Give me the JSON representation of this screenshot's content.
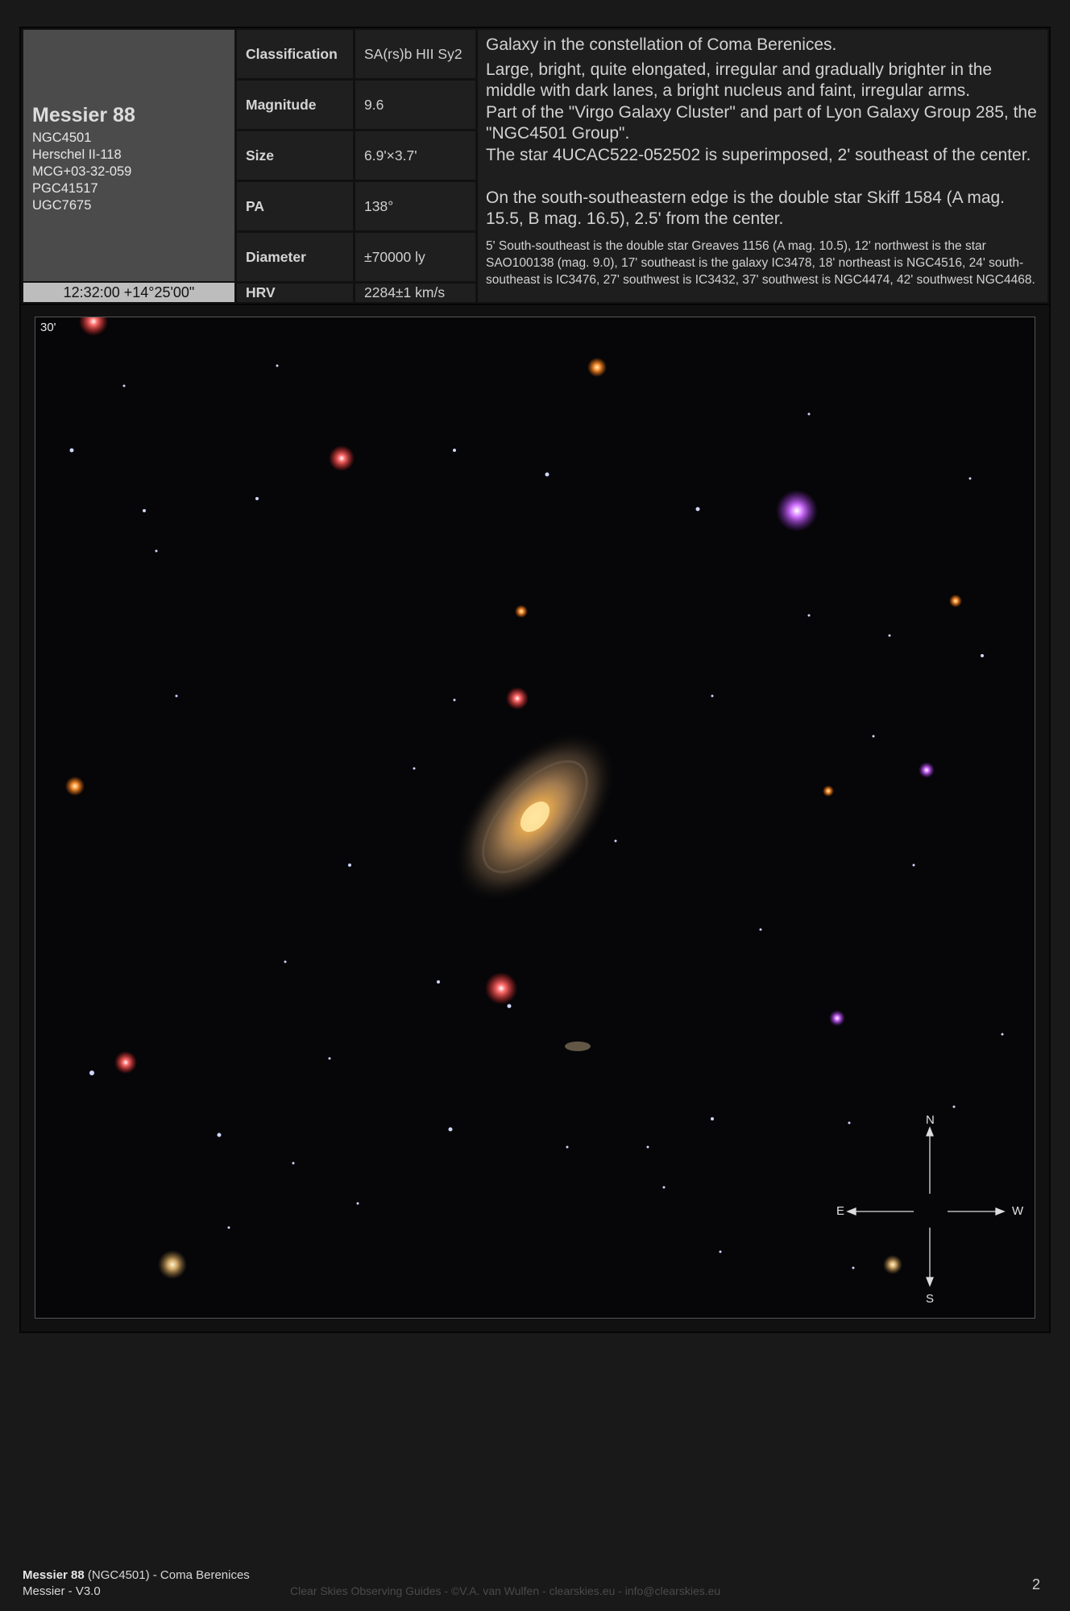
{
  "object": {
    "name": "Messier 88",
    "designations": [
      "NGC4501",
      "Herschel II-118",
      "MCG+03-32-059",
      "PGC41517",
      "UGC7675"
    ],
    "coordinates": "12:32:00 +14°25'00\""
  },
  "parameters": [
    {
      "label": "Classification",
      "value": "SA(rs)b HII Sy2"
    },
    {
      "label": "Magnitude",
      "value": "9.6"
    },
    {
      "label": "Size",
      "value": "6.9'×3.7'"
    },
    {
      "label": "PA",
      "value": "138°"
    },
    {
      "label": "Diameter",
      "value": "±70000 ly"
    },
    {
      "label": "HRV",
      "value": "2284±1 km/s"
    }
  ],
  "description": {
    "lines": [
      "Galaxy in the constellation of Coma Berenices.",
      "Large, bright, quite elongated, irregular and gradually brighter in the middle with dark lanes, a bright nucleus and faint, irregular arms.",
      "Part of the \"Virgo Galaxy Cluster\" and part of Lyon Galaxy Group 285, the \"NGC4501 Group\".",
      "The star 4UCAC522-052502 is superimposed, 2' southeast of the center.",
      "On the south-southeastern edge is the double star Skiff 1584 (A mag. 15.5, B mag. 16.5), 2.5' from the center."
    ],
    "small": "5' South-southeast is the double star Greaves 1156 (A mag. 10.5), 12' northwest is the star SAO100138 (mag. 9.0), 17' southeast is the galaxy IC3478, 18' northeast is NGC4516, 24' south-southeast is IC3476, 27' southwest is IC3432, 37' southwest is NGC4474, 42' southwest NGC4468."
  },
  "image": {
    "fov_label": "30'",
    "compass": {
      "n": "N",
      "s": "S",
      "e": "E",
      "w": "W"
    }
  },
  "footer": {
    "title_bold": "Messier 88",
    "title_rest": " (NGC4501) - Coma Berenices",
    "subtitle": "Messier - V3.0",
    "credit": "Clear Skies Observing Guides - ©V.A. van Wulfen - clearskies.eu - info@clearskies.eu",
    "page": "2"
  },
  "colors": {
    "page_bg": "#191919",
    "name_bg": "#4b4b4b",
    "coord_bg": "#bdbdbd",
    "cell_bg": "#1f1f1f"
  }
}
